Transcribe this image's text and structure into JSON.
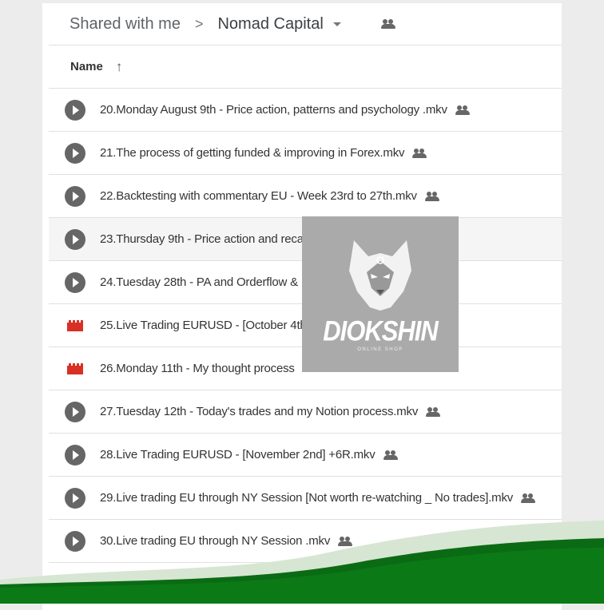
{
  "breadcrumb": {
    "parent": "Shared with me",
    "current": "Nomad Capital"
  },
  "column": {
    "name": "Name"
  },
  "files": [
    {
      "icon": "play",
      "name": "20.Monday August 9th - Price action, patterns and psychology .mkv",
      "shared": true
    },
    {
      "icon": "play",
      "name": "21.The process of getting funded & improving in Forex.mkv",
      "shared": true
    },
    {
      "icon": "play",
      "name": "22.Backtesting with commentary EU - Week 23rd to 27th.mkv",
      "shared": true
    },
    {
      "icon": "play",
      "name": "23.Thursday 9th - Price action and reca",
      "shared": false
    },
    {
      "icon": "play",
      "name": "24.Tuesday 28th - PA and Orderflow & ",
      "shared": false
    },
    {
      "icon": "video",
      "name": "25.Live Trading EURUSD - [October 4th]",
      "shared": false
    },
    {
      "icon": "video",
      "name": "26.Monday 11th - My thought process",
      "shared": false
    },
    {
      "icon": "play",
      "name": "27.Tuesday 12th - Today's trades and my Notion process.mkv",
      "shared": true
    },
    {
      "icon": "play",
      "name": "28.Live Trading EURUSD - [November 2nd] +6R.mkv",
      "shared": true
    },
    {
      "icon": "play",
      "name": "29.Live trading EU through NY Session [Not worth re-watching _ No trades].mkv",
      "shared": true
    },
    {
      "icon": "play",
      "name": "30.Live trading EU through NY Session .mkv",
      "shared": true
    }
  ],
  "watermark": {
    "brand": "DIOKSHIN",
    "sub": "ONLINE SHOP"
  },
  "colors": {
    "wave_dark": "#0b7a16",
    "wave_light": "#d6e6d2",
    "clapper": "#d93025"
  }
}
